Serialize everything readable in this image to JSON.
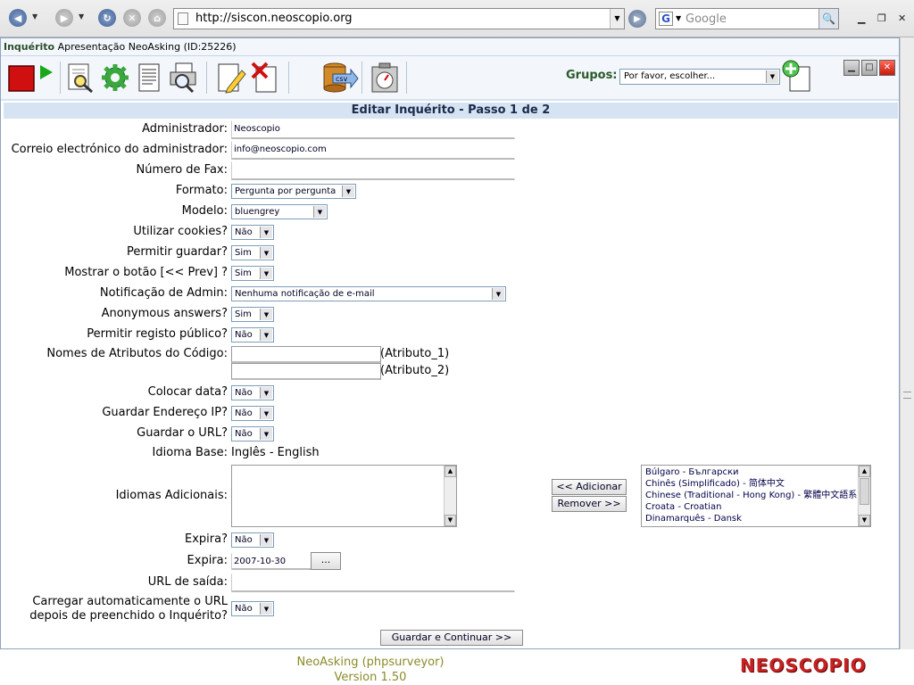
{
  "browser": {
    "url": "http://siscon.neoscopio.org",
    "search_placeholder": "Google"
  },
  "app": {
    "title_bold": "Inquérito",
    "title_rest": "Apresentação NeoAsking (ID:25226)",
    "grupos_label": "Grupos:",
    "grupos_value": "Por favor, escolher...",
    "icons": [
      "stop-icon",
      "play-icon",
      "inspect-icon",
      "settings-icon",
      "document-icon",
      "print-preview-icon",
      "edit-icon",
      "delete-icon",
      "csv-export-icon",
      "timer-icon",
      "add-group-icon"
    ]
  },
  "form": {
    "heading": "Editar Inquérito - Passo 1 de 2",
    "admin_label": "Administrador:",
    "admin_value": "Neoscopio",
    "email_label": "Correio electrónico do administrador:",
    "email_value": "info@neoscopio.com",
    "fax_label": "Número de Fax:",
    "fax_value": "",
    "format_label": "Formato:",
    "format_value": "Pergunta por pergunta",
    "template_label": "Modelo:",
    "template_value": "bluengrey",
    "cookies_label": "Utilizar cookies?",
    "cookies_value": "Não",
    "save_label": "Permitir guardar?",
    "save_value": "Sim",
    "prev_label": "Mostrar o botão [<< Prev] ?",
    "prev_value": "Sim",
    "notify_label": "Notificação de Admin:",
    "notify_value": "Nenhuma notificação de e-mail",
    "anon_label": "Anonymous answers?",
    "anon_value": "Sim",
    "public_label": "Permitir registo público?",
    "public_value": "Não",
    "attr_label": "Nomes de Atributos do Código:",
    "attr1_suffix": "(Atributo_1)",
    "attr2_suffix": "(Atributo_2)",
    "date_label": "Colocar data?",
    "date_value": "Não",
    "ip_label": "Guardar Endereço IP?",
    "ip_value": "Não",
    "url_label": "Guardar o URL?",
    "url_value": "Não",
    "base_lang_label": "Idioma Base:",
    "base_lang_value": "Inglês - English",
    "add_lang_label": "Idiomas Adicionais:",
    "add_button": "<< Adicionar",
    "remove_button": "Remover >>",
    "languages": [
      "Búlgaro - Български",
      "Chinês (Simplificado) - 简体中文",
      "Chinese (Traditional - Hong Kong) - 繁體中文語系",
      "Croata - Croatian",
      "Dinamarquês - Dansk"
    ],
    "expires_q_label": "Expira?",
    "expires_q_value": "Não",
    "expires_label": "Expira:",
    "expires_value": "2007-10-30",
    "date_picker_button": "...",
    "exit_url_label": "URL de saída:",
    "exit_url_value": "",
    "autoload_label": "Carregar automaticamente o URL depois de preenchido o Inquérito?",
    "autoload_value": "Não",
    "submit_button": "Guardar e Continuar >>"
  },
  "footer": {
    "line1": "NeoAsking (phpsurveyor)",
    "line2": "Version 1.50",
    "logo": "NEOSCOPIO"
  }
}
